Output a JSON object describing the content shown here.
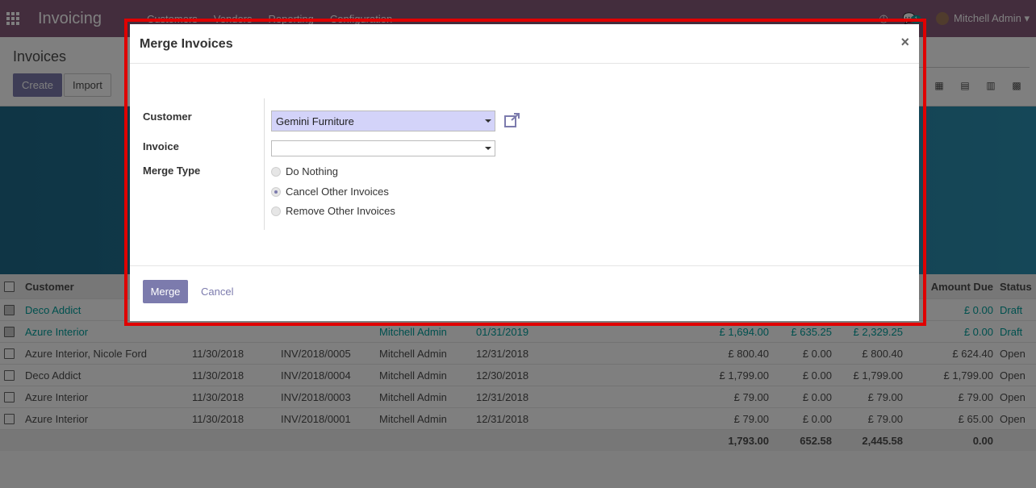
{
  "navbar": {
    "app_name": "Invoicing",
    "menu": [
      "Customers",
      "Vendors",
      "Reporting",
      "Configuration"
    ],
    "notification_count": "1",
    "user": "Mitchell Admin"
  },
  "control": {
    "title": "Invoices",
    "create_label": "Create",
    "import_label": "Import"
  },
  "table": {
    "header_customer": "Customer",
    "header_amount_due": "Amount Due",
    "header_status": "Status",
    "rows": [
      {
        "customer": "Deco Addict",
        "inv_date": "",
        "number": "",
        "salesperson": "",
        "due": "",
        "untaxed": "",
        "tax": "",
        "total": "",
        "amount_due": "£ 0.00",
        "status": "Draft",
        "checked": true,
        "draft": true
      },
      {
        "customer": "Azure Interior",
        "inv_date": "",
        "number": "",
        "salesperson": "Mitchell Admin",
        "due": "01/31/2019",
        "untaxed": "£ 1,694.00",
        "tax": "£ 635.25",
        "total": "£ 2,329.25",
        "amount_due": "£ 0.00",
        "status": "Draft",
        "checked": true,
        "draft": true
      },
      {
        "customer": "Azure Interior, Nicole Ford",
        "inv_date": "11/30/2018",
        "number": "INV/2018/0005",
        "salesperson": "Mitchell Admin",
        "due": "12/31/2018",
        "untaxed": "£ 800.40",
        "tax": "£ 0.00",
        "total": "£ 800.40",
        "amount_due": "£ 624.40",
        "status": "Open",
        "checked": false,
        "draft": false
      },
      {
        "customer": "Deco Addict",
        "inv_date": "11/30/2018",
        "number": "INV/2018/0004",
        "salesperson": "Mitchell Admin",
        "due": "12/30/2018",
        "untaxed": "£ 1,799.00",
        "tax": "£ 0.00",
        "total": "£ 1,799.00",
        "amount_due": "£ 1,799.00",
        "status": "Open",
        "checked": false,
        "draft": false
      },
      {
        "customer": "Azure Interior",
        "inv_date": "11/30/2018",
        "number": "INV/2018/0003",
        "salesperson": "Mitchell Admin",
        "due": "12/31/2018",
        "untaxed": "£ 79.00",
        "tax": "£ 0.00",
        "total": "£ 79.00",
        "amount_due": "£ 79.00",
        "status": "Open",
        "checked": false,
        "draft": false
      },
      {
        "customer": "Azure Interior",
        "inv_date": "11/30/2018",
        "number": "INV/2018/0001",
        "salesperson": "Mitchell Admin",
        "due": "12/31/2018",
        "untaxed": "£ 79.00",
        "tax": "£ 0.00",
        "total": "£ 79.00",
        "amount_due": "£ 65.00",
        "status": "Open",
        "checked": false,
        "draft": false
      }
    ],
    "totals": {
      "untaxed": "1,793.00",
      "tax": "652.58",
      "total": "2,445.58",
      "amount_due": "0.00"
    }
  },
  "modal": {
    "title": "Merge Invoices",
    "close_glyph": "×",
    "customer_label": "Customer",
    "customer_value": "Gemini Furniture",
    "invoice_label": "Invoice",
    "invoice_value": "",
    "merge_type_label": "Merge Type",
    "options": [
      {
        "label": "Do Nothing",
        "selected": false
      },
      {
        "label": "Cancel Other Invoices",
        "selected": true
      },
      {
        "label": "Remove Other Invoices",
        "selected": false
      }
    ],
    "merge_label": "Merge",
    "cancel_label": "Cancel"
  },
  "colors": {
    "primary": "#875a7b",
    "accent": "#7c7bad",
    "link": "#00a09d",
    "highlight": "#e00000"
  }
}
